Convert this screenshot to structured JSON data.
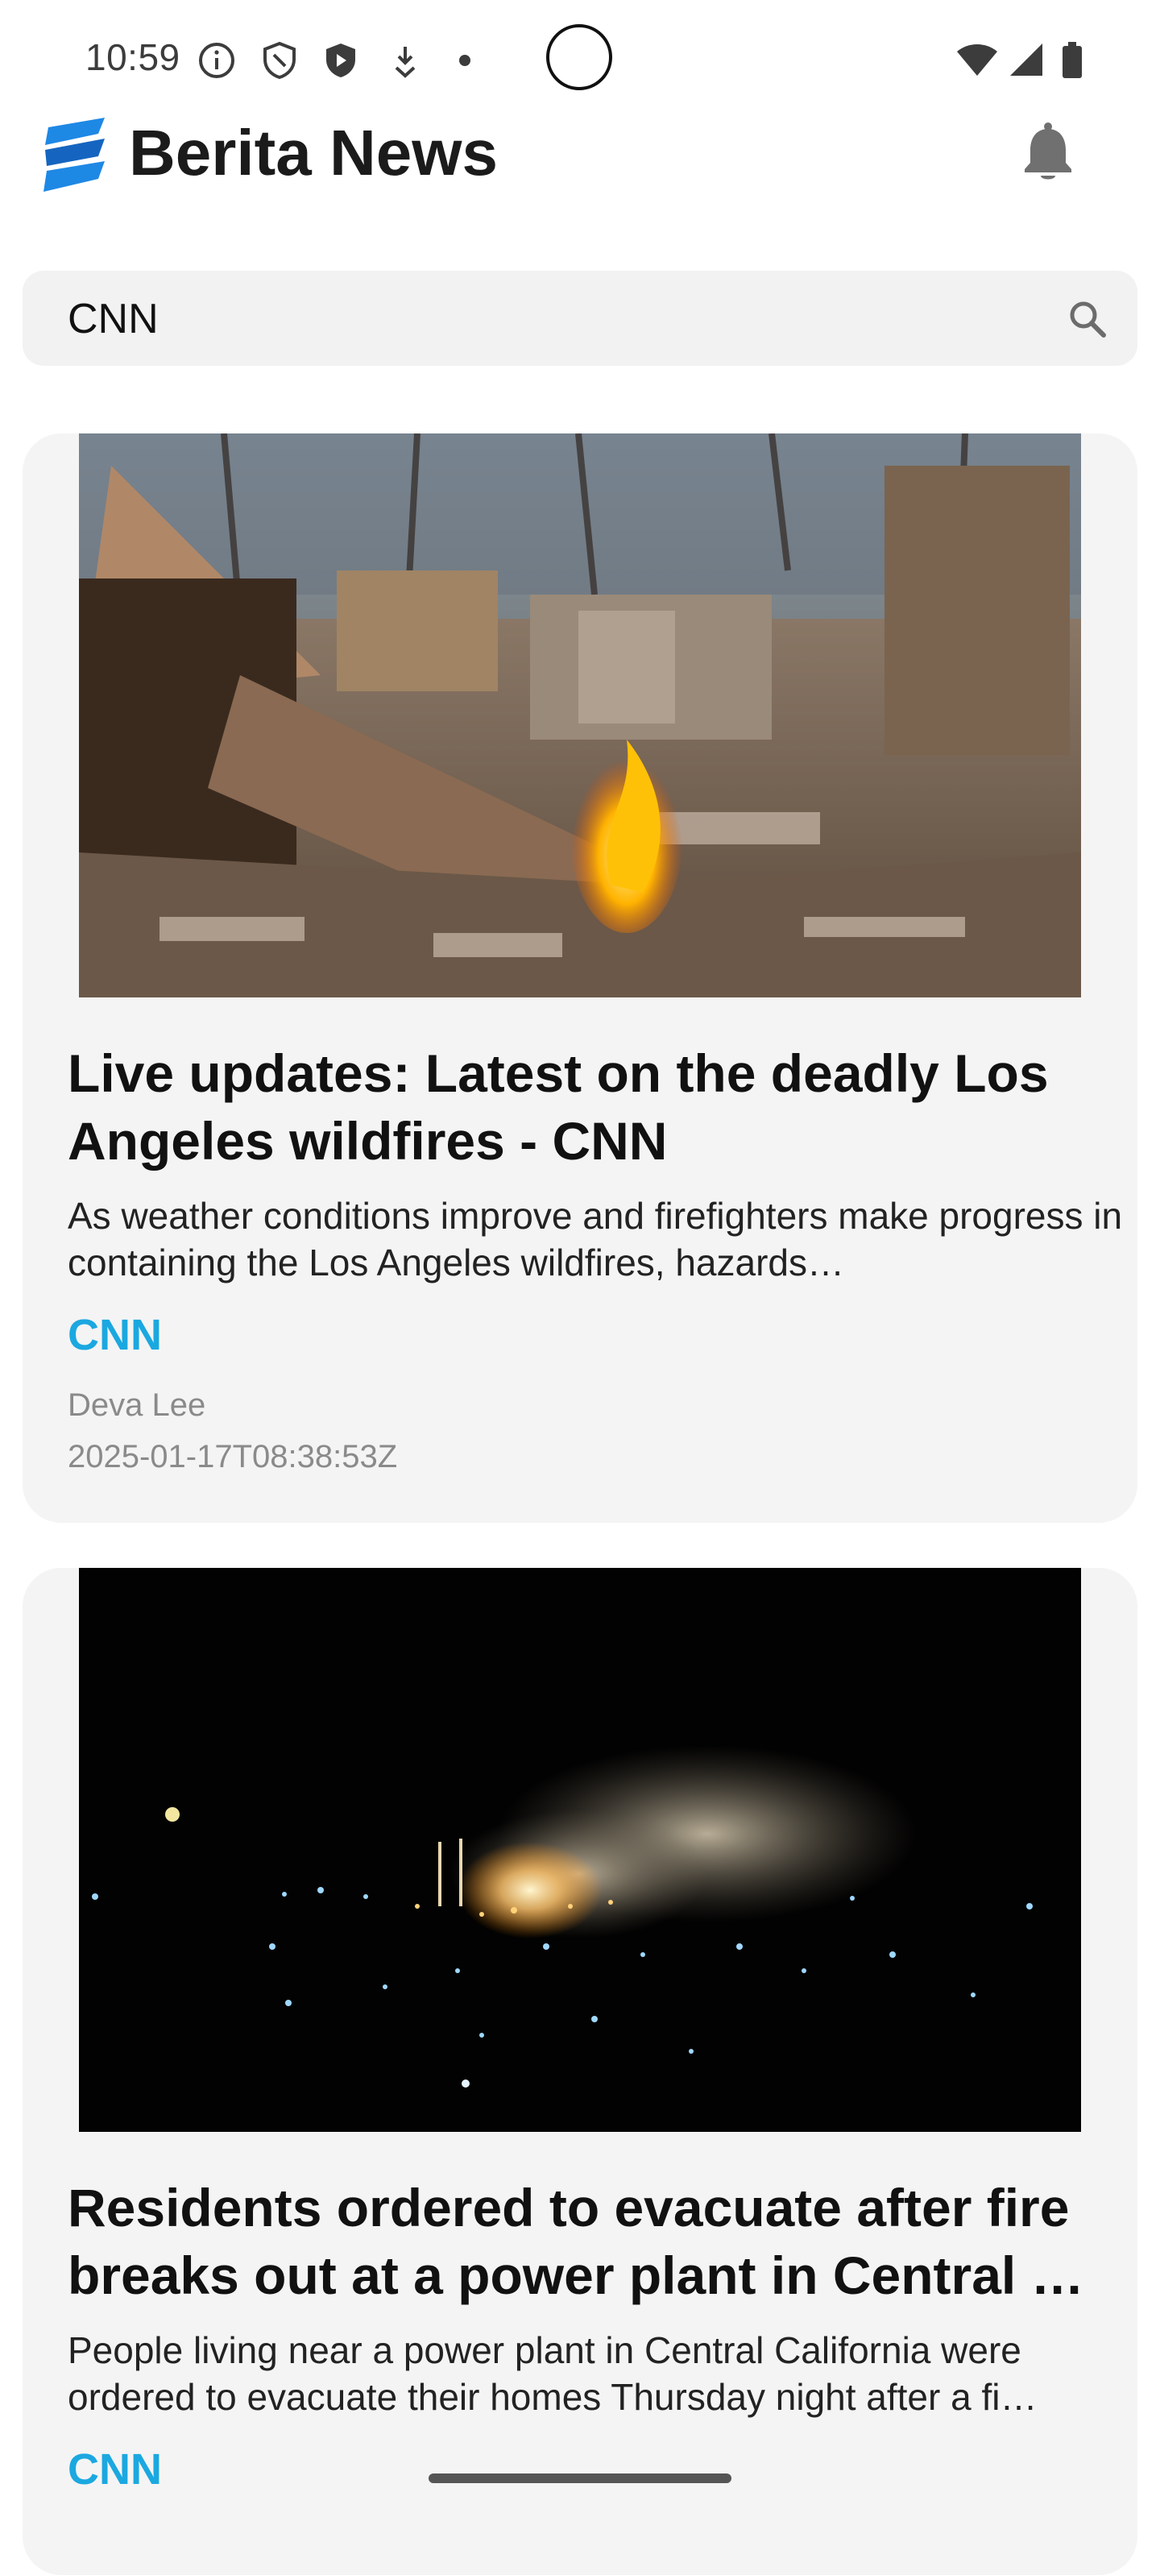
{
  "status_bar": {
    "time": "10:59",
    "left_icons": [
      "info-icon",
      "shield-outline-icon",
      "shield-filled-icon",
      "download-icon",
      "dot-icon"
    ],
    "right_icons": [
      "wifi-icon",
      "signal-icon",
      "battery-icon"
    ]
  },
  "header": {
    "title": "Berita News",
    "logo": "berita-logo-icon",
    "notification_icon": "bell-icon"
  },
  "search": {
    "value": "CNN",
    "icon": "search-icon"
  },
  "colors": {
    "accent": "#1ba8e0",
    "card_background": "#f4f4f4",
    "search_background": "#f2f2f2",
    "meta_text": "#8a8a8a"
  },
  "articles": [
    {
      "title": "Live updates: Latest on the deadly Los Angeles wildfires - CNN",
      "description": "As weather conditions improve and firefighters make progress in containing the Los Angeles wildfires, hazards…",
      "source": "CNN",
      "author": "Deva Lee",
      "published": "2025-01-17T08:38:53Z"
    },
    {
      "title": "Residents ordered to evacuate after fire breaks out at a power plant in Central …",
      "description": "People living near a power plant in Central California were ordered to evacuate their homes Thursday night after a fi…",
      "source": "CNN"
    }
  ]
}
